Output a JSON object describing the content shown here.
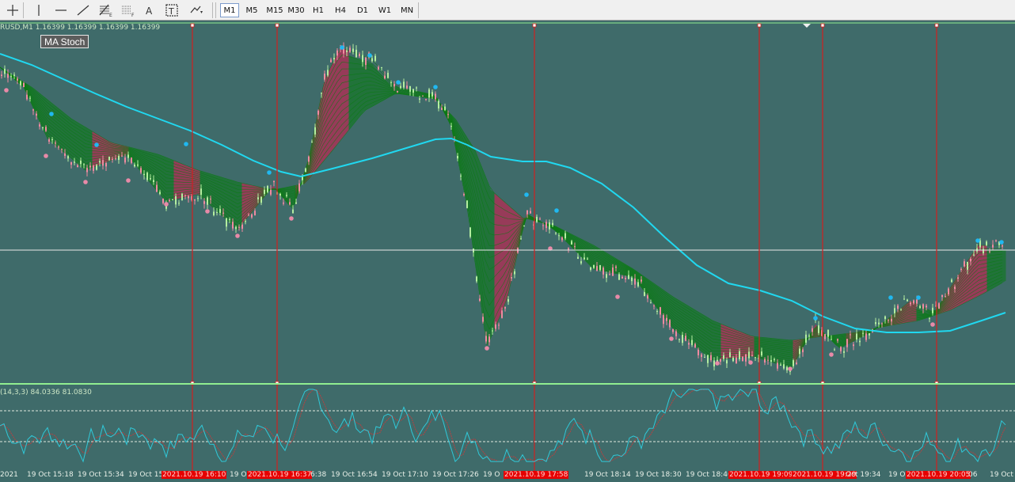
{
  "toolbar": {
    "tools": [
      {
        "name": "crosshair-icon"
      },
      {
        "name": "vertical-line-icon"
      },
      {
        "name": "horizontal-line-icon"
      },
      {
        "name": "trendline-icon"
      },
      {
        "name": "fibonacci-icon",
        "sub": "E"
      },
      {
        "name": "fibo-fan-icon",
        "sub": "F"
      },
      {
        "name": "text-icon",
        "label": "A"
      },
      {
        "name": "text-label-icon",
        "label": "T"
      },
      {
        "name": "arrows-icon"
      }
    ],
    "timeframes": [
      "M1",
      "M5",
      "M15",
      "M30",
      "H1",
      "H4",
      "D1",
      "W1",
      "MN"
    ],
    "active_timeframe": "M1"
  },
  "chart": {
    "symbol_info": "RUSD,M1  1.16399 1.16399 1.16399 1.16399",
    "indicator_button": "MA Stoch",
    "sub_window_label": "(14,3,3) 84.0336 81.0830",
    "x_labels": [
      {
        "text": "2021",
        "highlight": false
      },
      {
        "text": "19 Oct 15:18",
        "highlight": false
      },
      {
        "text": "19 Oct 15:34",
        "highlight": false
      },
      {
        "text": "19 Oct 15",
        "highlight": false
      },
      {
        "text": "2021.10.19 16:10",
        "highlight": true
      },
      {
        "text": "19 O",
        "highlight": false
      },
      {
        "text": "2021.10.19 16:37",
        "highlight": true
      },
      {
        "text": "6:38",
        "highlight": false
      },
      {
        "text": "19 Oct 16:54",
        "highlight": false
      },
      {
        "text": "19 Oct 17:10",
        "highlight": false
      },
      {
        "text": "19 Oct 17:26",
        "highlight": false
      },
      {
        "text": "19 O",
        "highlight": false
      },
      {
        "text": "2021.10.19 17:58",
        "highlight": true
      },
      {
        "text": "19 Oct 18:14",
        "highlight": false
      },
      {
        "text": "19 Oct 18:30",
        "highlight": false
      },
      {
        "text": "19 Oct 18:46",
        "highlight": false
      },
      {
        "text": "2021.10.19 19:09",
        "highlight": true
      },
      {
        "text": "2021.10.19 19:29",
        "highlight": true
      },
      {
        "text": "Oct 19:34",
        "highlight": false
      },
      {
        "text": "19 O",
        "highlight": false
      },
      {
        "text": "2021.10.19 20:05",
        "highlight": true
      },
      {
        "text": ":06",
        "highlight": false
      },
      {
        "text": "19 Oct",
        "highlight": false
      }
    ]
  },
  "colors": {
    "background": "#3f6b6a",
    "ma_slow": "#20d8f0",
    "ribbon_bull": "#0a7a12",
    "ribbon_bear": "#e0144a",
    "candle_bull": "#b4eea0",
    "candle_bear": "#f08aa0",
    "vline": "#d02020",
    "stoch_main": "#30c8d8",
    "stoch_signal": "#b84040"
  }
}
